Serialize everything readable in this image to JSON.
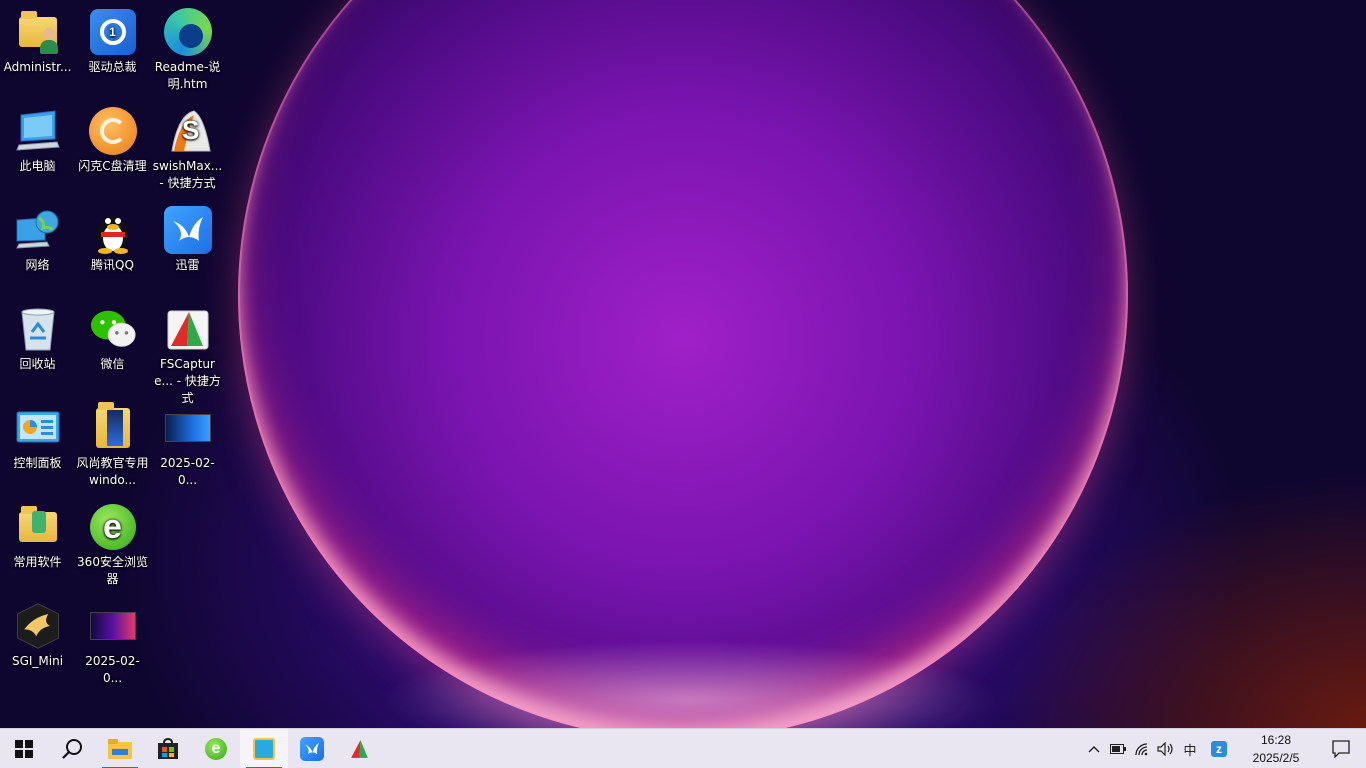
{
  "desktop": {
    "icons": [
      {
        "label": "Administr..."
      },
      {
        "label": "驱动总裁"
      },
      {
        "label": "Readme-说明.htm"
      },
      {
        "label": "此电脑"
      },
      {
        "label": "闪克C盘清理"
      },
      {
        "label": "swishMax... - 快捷方式"
      },
      {
        "label": "网络"
      },
      {
        "label": "腾讯QQ"
      },
      {
        "label": "迅雷"
      },
      {
        "label": "回收站"
      },
      {
        "label": "微信"
      },
      {
        "label": "FSCapture... - 快捷方式"
      },
      {
        "label": "控制面板"
      },
      {
        "label": "风尚教官专用windo..."
      },
      {
        "label": "2025-02-0..."
      },
      {
        "label": "常用软件"
      },
      {
        "label": "360安全浏览器"
      },
      {
        "label": "SGI_Mini"
      },
      {
        "label": "2025-02-0..."
      }
    ]
  },
  "taskbar": {
    "tray": {
      "ime": "中",
      "time": "16:28",
      "date": "2025/2/5"
    }
  },
  "colors": {
    "taskbar_bg": "#eae6f1",
    "accent": "#1f6fd6"
  }
}
